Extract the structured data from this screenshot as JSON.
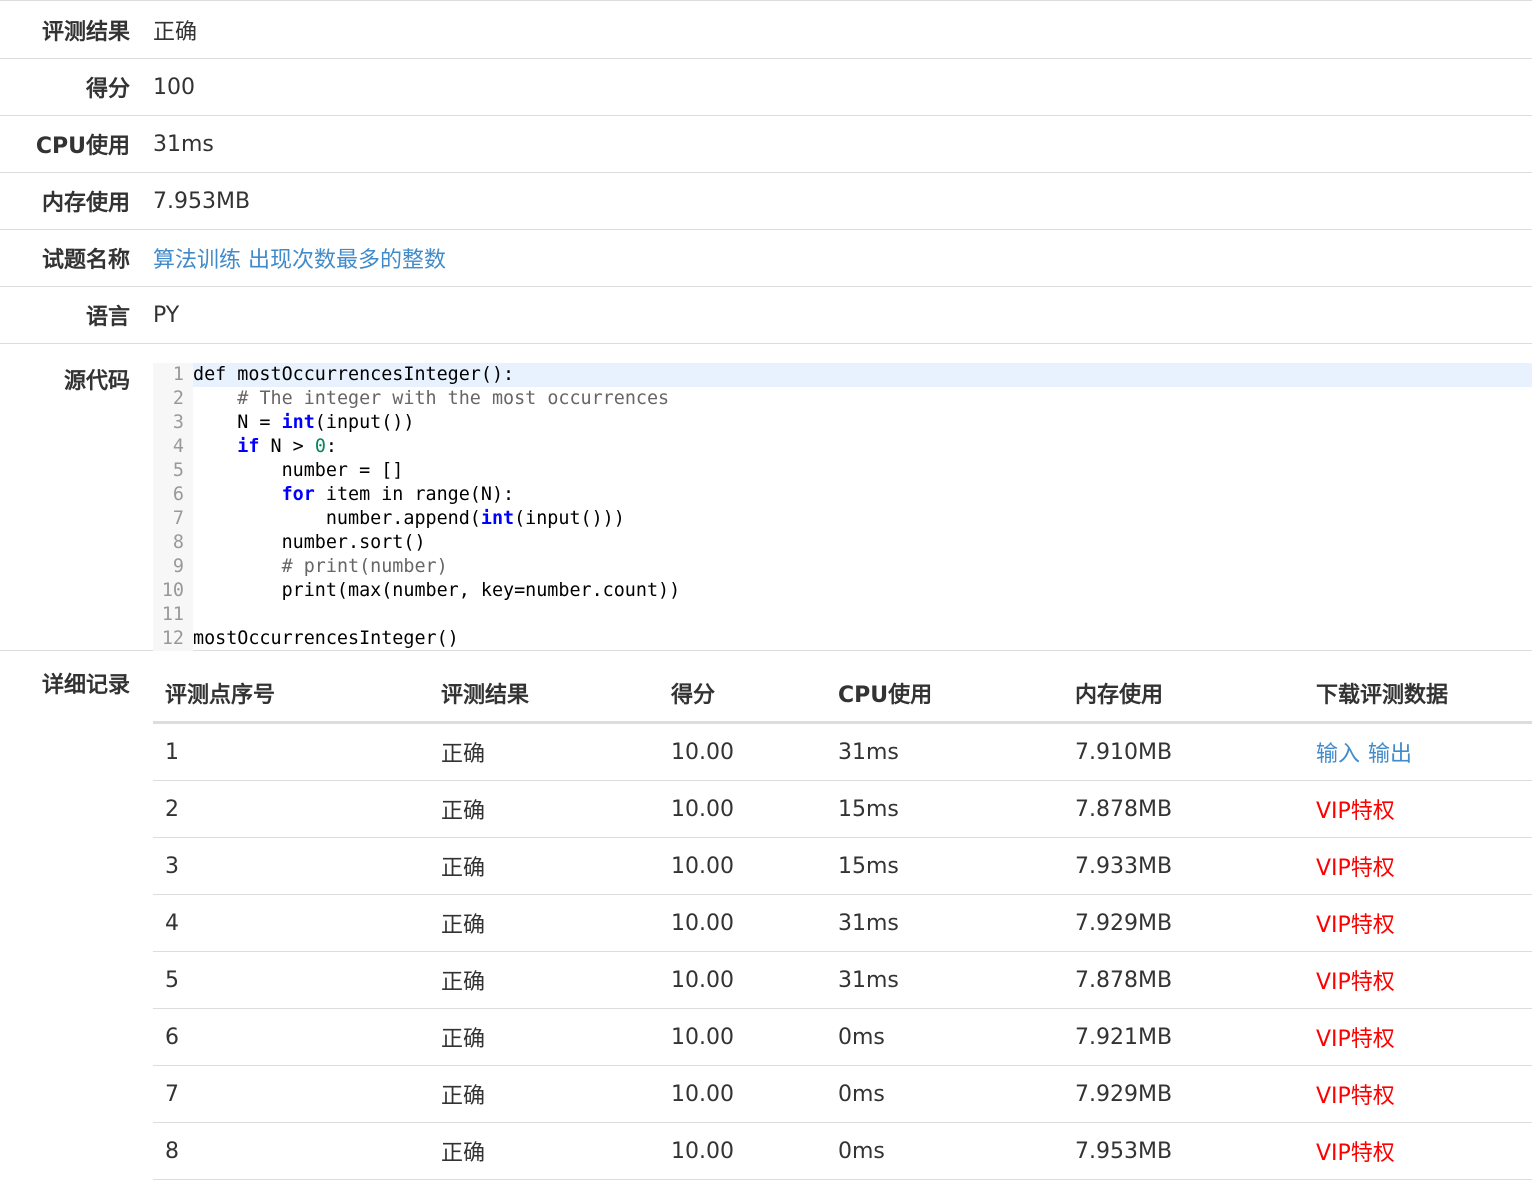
{
  "summary": {
    "result_label": "评测结果",
    "result_value": "正确",
    "score_label": "得分",
    "score_value": "100",
    "cpu_label": "CPU使用",
    "cpu_value": "31ms",
    "mem_label": "内存使用",
    "mem_value": "7.953MB",
    "problem_label": "试题名称",
    "problem_value": "算法训练 出现次数最多的整数",
    "lang_label": "语言",
    "lang_value": "PY",
    "source_label": "源代码"
  },
  "code": {
    "line_numbers": [
      "1",
      "2",
      "3",
      "4",
      "5",
      "6",
      "7",
      "8",
      "9",
      "10",
      "11",
      "12"
    ]
  },
  "details": {
    "label": "详细记录",
    "headers": [
      "评测点序号",
      "评测结果",
      "得分",
      "CPU使用",
      "内存使用",
      "下载评测数据"
    ],
    "rows": [
      {
        "id": "1",
        "result": "正确",
        "score": "10.00",
        "cpu": "31ms",
        "mem": "7.910MB"
      },
      {
        "id": "2",
        "result": "正确",
        "score": "10.00",
        "cpu": "15ms",
        "mem": "7.878MB",
        "vip": "VIP特权"
      },
      {
        "id": "3",
        "result": "正确",
        "score": "10.00",
        "cpu": "15ms",
        "mem": "7.933MB",
        "vip": "VIP特权"
      },
      {
        "id": "4",
        "result": "正确",
        "score": "10.00",
        "cpu": "31ms",
        "mem": "7.929MB",
        "vip": "VIP特权"
      },
      {
        "id": "5",
        "result": "正确",
        "score": "10.00",
        "cpu": "31ms",
        "mem": "7.878MB",
        "vip": "VIP特权"
      },
      {
        "id": "6",
        "result": "正确",
        "score": "10.00",
        "cpu": "0ms",
        "mem": "7.921MB",
        "vip": "VIP特权"
      },
      {
        "id": "7",
        "result": "正确",
        "score": "10.00",
        "cpu": "0ms",
        "mem": "7.929MB",
        "vip": "VIP特权"
      },
      {
        "id": "8",
        "result": "正确",
        "score": "10.00",
        "cpu": "0ms",
        "mem": "7.953MB",
        "vip": "VIP特权"
      }
    ],
    "input_link": "输入",
    "output_link": "输出"
  }
}
